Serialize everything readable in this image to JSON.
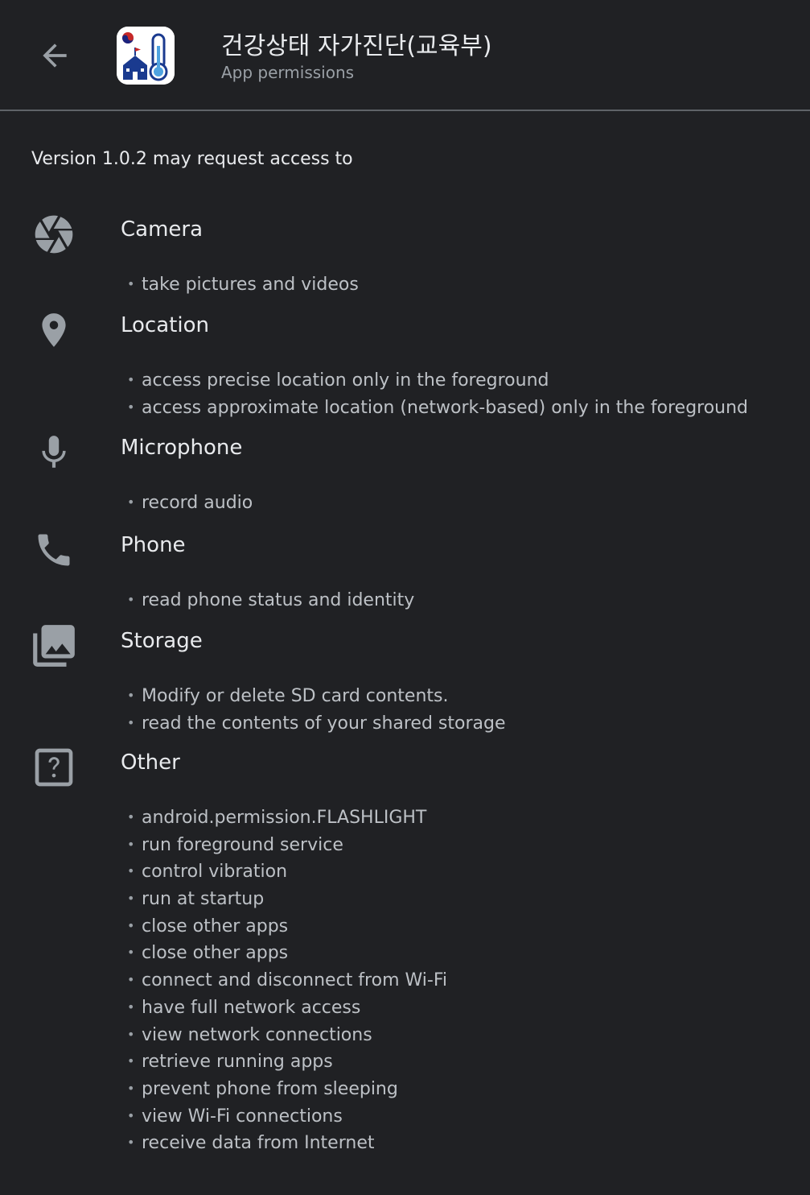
{
  "header": {
    "back_icon": "arrow-back-icon",
    "app_icon": "app-logo-thermometer-school-icon",
    "title": "건강상태 자가진단(교육부)",
    "subtitle": "App permissions"
  },
  "intro": "Version 1.0.2 may request access to",
  "groups": [
    {
      "title": "Camera",
      "icon": "camera-aperture-icon",
      "items": [
        "take pictures and videos"
      ]
    },
    {
      "title": "Location",
      "icon": "location-pin-icon",
      "items": [
        "access precise location only in the foreground",
        "access approximate location (network-based) only in the foreground"
      ]
    },
    {
      "title": "Microphone",
      "icon": "microphone-icon",
      "items": [
        "record audio"
      ]
    },
    {
      "title": "Phone",
      "icon": "phone-icon",
      "items": [
        "read phone status and identity"
      ]
    },
    {
      "title": "Storage",
      "icon": "photo-library-icon",
      "items": [
        "Modify or delete SD card contents.",
        "read the contents of your shared storage"
      ]
    },
    {
      "title": "Other",
      "icon": "help-box-icon",
      "items": [
        "android.permission.FLASHLIGHT",
        "run foreground service",
        "control vibration",
        "run at startup",
        "close other apps",
        "close other apps",
        "connect and disconnect from Wi-Fi",
        "have full network access",
        "view network connections",
        "retrieve running apps",
        "prevent phone from sleeping",
        "view Wi-Fi connections",
        "receive data from Internet"
      ]
    }
  ],
  "colors": {
    "background": "#202124",
    "primary_text": "#e8eaed",
    "secondary_text": "#bdc1c6",
    "icon": "#9aa0a6",
    "divider": "#5f6368"
  }
}
